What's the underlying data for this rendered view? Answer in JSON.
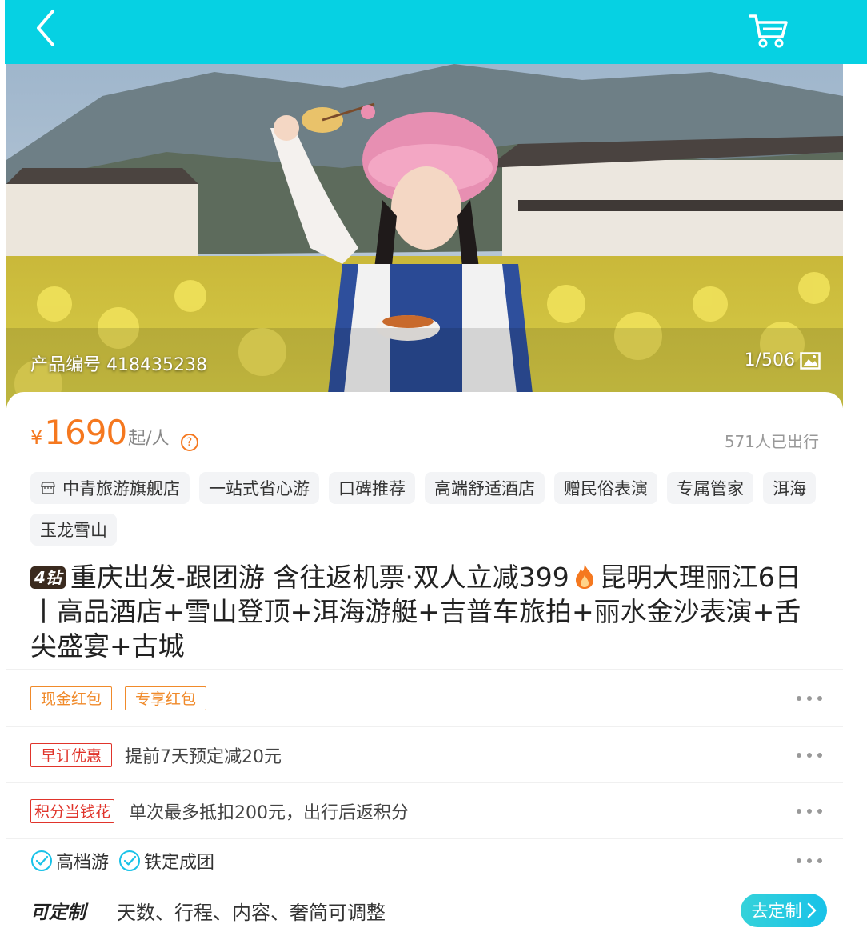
{
  "header": {
    "back_icon": "chevron-left-icon",
    "cart_icon": "cart-icon",
    "background_color": "#06d1e3"
  },
  "gallery": {
    "product_id_label": "产品编号 418435238",
    "counter": "1/506",
    "counter_icon": "image-icon"
  },
  "price": {
    "currency": "¥",
    "value": "1690",
    "unit": "起/人",
    "help_icon": "question-circle-icon",
    "travelers": "571人已出行",
    "accent_color": "#f5781f"
  },
  "tags": [
    {
      "label": "中青旅游旗舰店",
      "icon": "store-icon"
    },
    {
      "label": "一站式省心游"
    },
    {
      "label": "口碑推荐"
    },
    {
      "label": "高端舒适酒店"
    },
    {
      "label": "赠民俗表演"
    },
    {
      "label": "专属管家"
    },
    {
      "label": "洱海"
    },
    {
      "label": "玉龙雪山"
    }
  ],
  "title": {
    "badge": "4钻",
    "part1": "重庆出发-跟团游 含往返机票·双人立减399",
    "flame_icon": "flame-icon",
    "part2": "昆明大理丽江6日丨高品酒店+雪山登顶+洱海游艇+吉普车旅拍+丽水金沙表演+舌尖盛宴+古城"
  },
  "coupons": {
    "items": [
      "现金红包",
      "专享红包"
    ],
    "more_icon": "more-dots-icon"
  },
  "promotions": [
    {
      "tag": "早订优惠",
      "text": "提前7天预定减20元"
    },
    {
      "tag": "积分当钱花",
      "text": "单次最多抵扣200元，出行后返积分"
    }
  ],
  "badges": [
    {
      "label": "高档游",
      "icon": "check-circle-icon"
    },
    {
      "label": "铁定成团",
      "icon": "check-circle-icon"
    }
  ],
  "customize": {
    "logo": "可定制",
    "description": "天数、行程、内容、奢简可调整",
    "button_label": "去定制"
  }
}
